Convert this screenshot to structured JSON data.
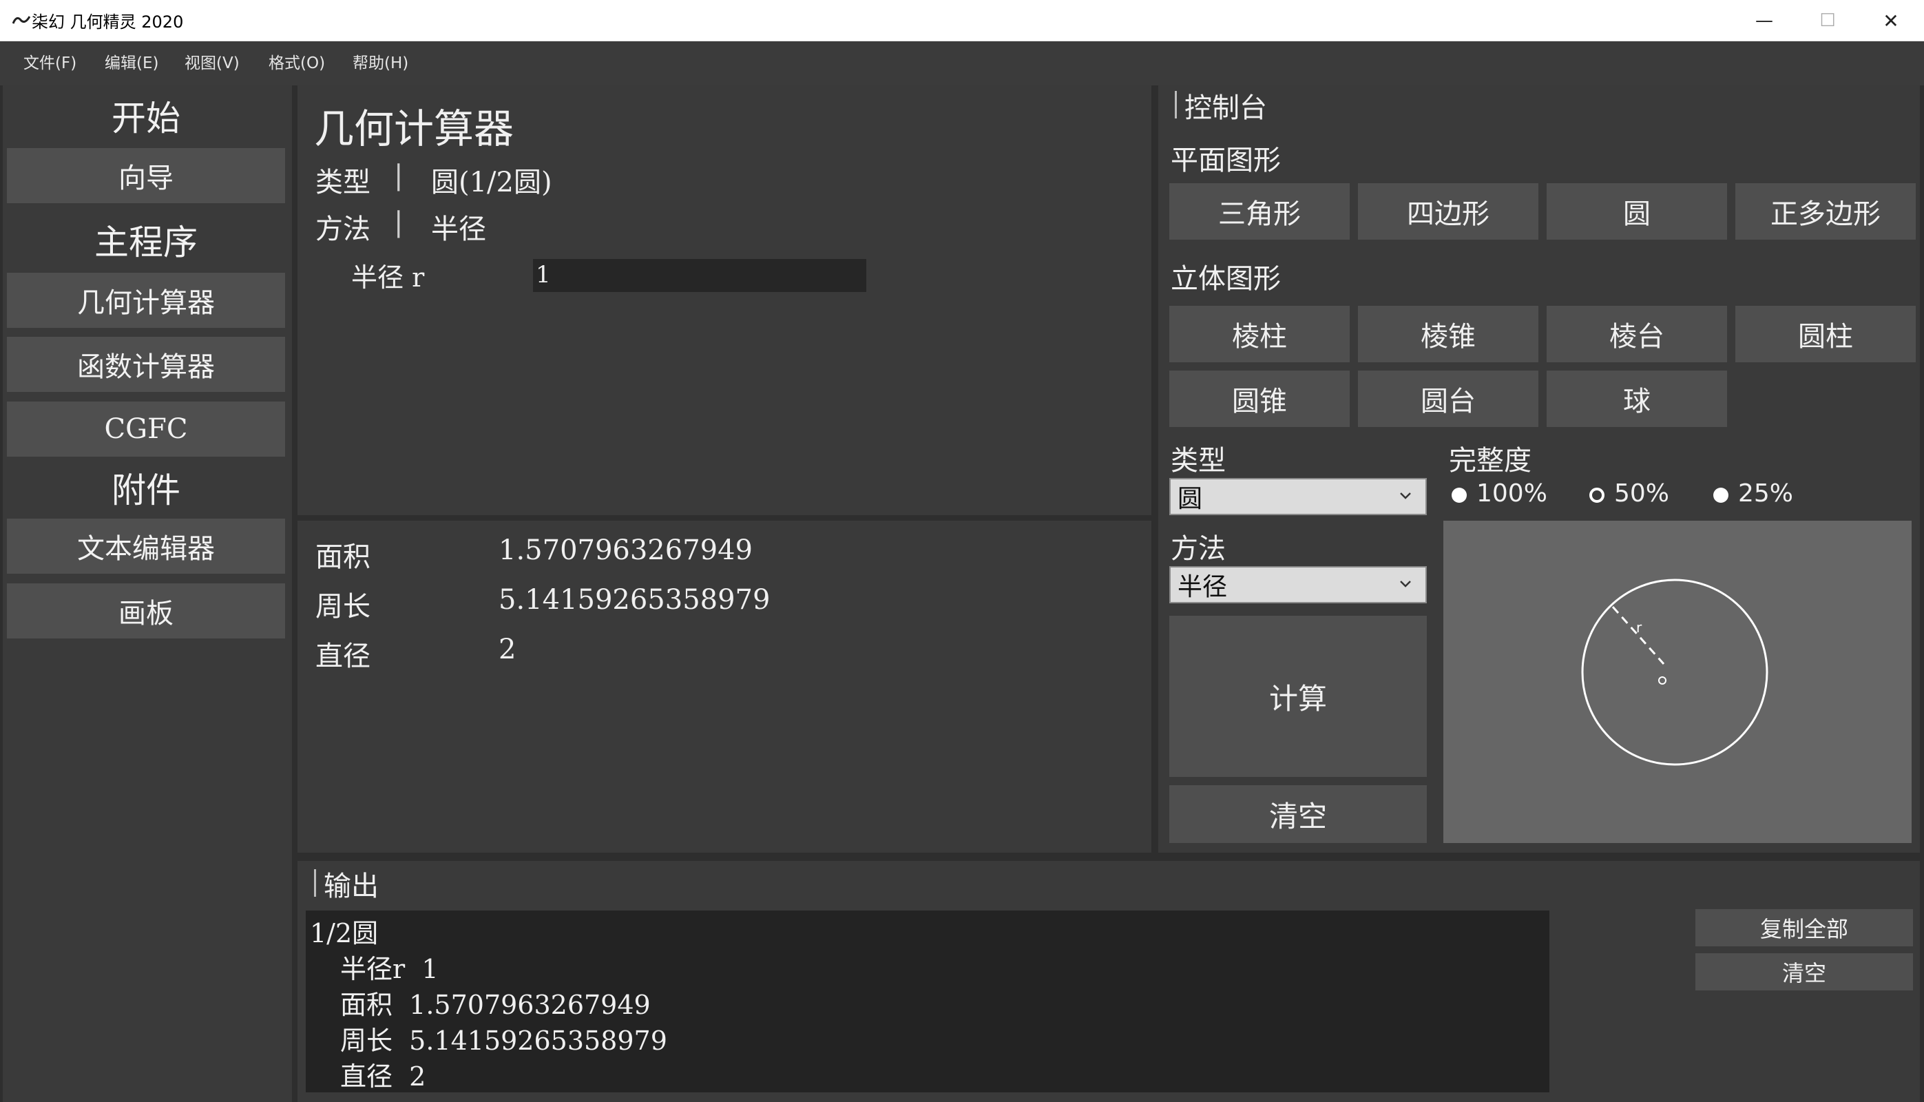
{
  "window": {
    "title": "柒幻 几何精灵 2020",
    "controls": {
      "minimize": "—",
      "maximize": "☐",
      "close": "✕"
    }
  },
  "menu": [
    "文件(F)",
    "编辑(E)",
    "视图(V)",
    "格式(O)",
    "帮助(H)"
  ],
  "sidebar": {
    "start_header": "开始",
    "wizard": "向导",
    "main_header": "主程序",
    "geometry_calc": "几何计算器",
    "function_calc": "函数计算器",
    "cgfc": "CGFC",
    "attachments_header": "附件",
    "text_editor": "文本编辑器",
    "drawing_board": "画板"
  },
  "calculator": {
    "title": "几何计算器",
    "type_label": "类型",
    "separator": "|",
    "type_value": "圆(1/2圆)",
    "method_label": "方法",
    "method_value": "半径",
    "radius_label": "半径 r",
    "radius_value": "1"
  },
  "results": [
    {
      "label": "面积",
      "value": "1.5707963267949"
    },
    {
      "label": "周长",
      "value": "5.14159265358979"
    },
    {
      "label": "直径",
      "value": "2"
    }
  ],
  "console": {
    "title": "控制台",
    "plane_header": "平面图形",
    "plane_shapes": [
      "三角形",
      "四边形",
      "圆",
      "正多边形"
    ],
    "solid_header": "立体图形",
    "solid_shapes": [
      "棱柱",
      "棱锥",
      "棱台",
      "圆柱",
      "圆锥",
      "圆台",
      "球"
    ],
    "type_label": "类型",
    "type_select": "圆",
    "integrity_label": "完整度",
    "integrity_options": [
      "100%",
      "50%",
      "25%"
    ],
    "method_label": "方法",
    "method_select": "半径",
    "calculate": "计算",
    "clear": "清空",
    "diagram": {
      "radius_label": "r",
      "center_label": "o"
    }
  },
  "output": {
    "title": "输出",
    "lines": [
      "1/2圆",
      "半径r  1",
      "面积  1.5707963267949",
      "周长  5.14159265358979",
      "直径  2"
    ],
    "copy_all": "复制全部",
    "clear": "清空"
  },
  "colors": {
    "background": "#2e2e2e",
    "panel": "#3a3a3a",
    "button": "#4f4f4f",
    "text": "#f0f0f0",
    "output_bg": "#232323",
    "diagram_bg": "#666666"
  }
}
